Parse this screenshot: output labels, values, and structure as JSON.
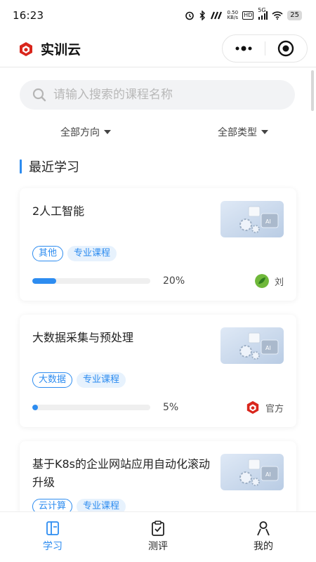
{
  "status_bar": {
    "time": "16:23",
    "network_speed_top": "0.50",
    "network_speed_bottom": "KB/s",
    "hd_label": "HD",
    "signal_label": "5G",
    "battery": "25",
    "icons": [
      "alarm-icon",
      "bluetooth-icon",
      "nfc-icon",
      "wifi-icon",
      "battery-icon"
    ]
  },
  "header": {
    "title": "实训云",
    "logo_icon": "shixun-logo-icon",
    "capsule": [
      "more-icon",
      "close-target-icon"
    ]
  },
  "search": {
    "placeholder": "请输入搜索的课程名称",
    "icon": "search-icon"
  },
  "filters": {
    "direction": "全部方向",
    "type": "全部类型"
  },
  "section": {
    "title": "最近学习"
  },
  "courses": [
    {
      "title": "2人工智能",
      "tags": [
        "其他",
        "专业课程"
      ],
      "progress": 20,
      "progress_text": "20%",
      "owner": "刘",
      "owner_avatar": "leaf-avatar-icon"
    },
    {
      "title": "大数据采集与预处理",
      "tags": [
        "大数据",
        "专业课程"
      ],
      "progress": 5,
      "progress_text": "5%",
      "owner": "官方",
      "owner_avatar": "shixun-logo-icon"
    },
    {
      "title": "基于K8s的企业网站应用自动化滚动升级",
      "tags": [
        "云计算",
        "专业课程"
      ]
    }
  ],
  "bottom_nav": [
    {
      "label": "学习",
      "icon": "study-icon",
      "active": true
    },
    {
      "label": "测评",
      "icon": "clipboard-icon",
      "active": false
    },
    {
      "label": "我的",
      "icon": "user-icon",
      "active": false
    }
  ],
  "colors": {
    "accent": "#2d8cf0",
    "brand_red": "#d9261c"
  }
}
